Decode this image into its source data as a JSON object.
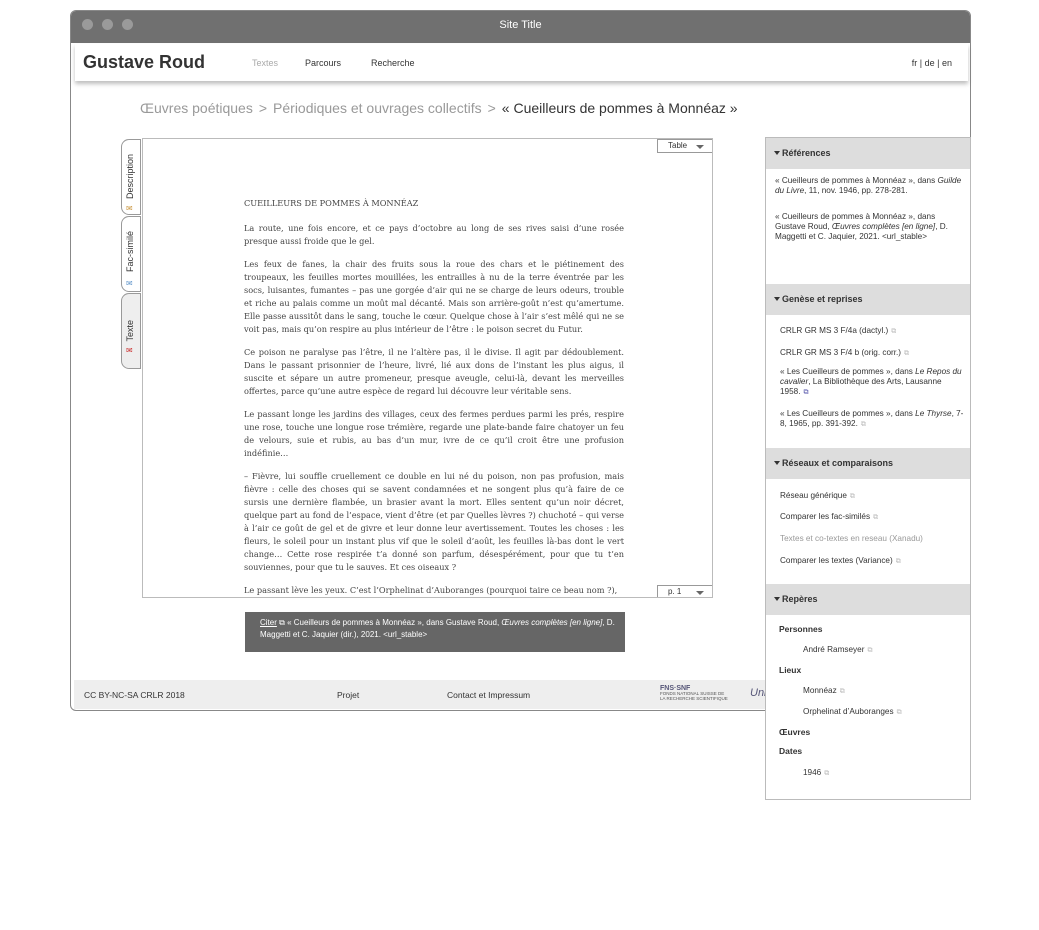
{
  "window": {
    "title": "Site Title"
  },
  "header": {
    "brand": "Gustave Roud",
    "nav": [
      "Textes",
      "Parcours",
      "Recherche"
    ],
    "langs": "fr | de | en"
  },
  "breadcrumb": {
    "items": [
      "Œuvres poétiques",
      "Périodiques et ouvrages collectifs"
    ],
    "separator": ">",
    "current": "« Cueilleurs de pommes à Monnéaz »"
  },
  "sidetabs": [
    {
      "label": "Description",
      "icon": "✉"
    },
    {
      "label": "Fac-similé",
      "icon": "✉"
    },
    {
      "label": "Texte",
      "icon": "✉"
    }
  ],
  "viewer": {
    "table_label": "Table",
    "page_label": "p. 1",
    "doc_title": "CUEILLEURS DE POMMES À MONNÉAZ",
    "paragraphs": [
      "La route, une fois encore, et ce pays d’octobre au long de ses rives saisi d’une rosée presque aussi froide que le gel.",
      "Les feux de fanes, la chair des fruits sous la roue des chars et le piétinement des troupeaux, les feuilles mortes mouillées, les entrailles à nu de la terre éventrée par les socs, luisantes, fumantes – pas une gorgée d’air qui ne se charge de leurs odeurs, trouble et riche au palais comme un moût mal décanté. Mais son arrière-goût n’est qu’amertume. Elle passe aussitôt dans le sang, touche le cœur. Quelque chose à l’air s’est mêlé qui ne se voit pas, mais qu’on respire au plus intérieur de l’être : le poison secret du Futur.",
      "Ce poison ne paralyse pas l’être, il ne l’altère pas, il le divise. Il agit par dédoublement. Dans le passant prisonnier de l’heure, livré, lié aux dons de l’instant les plus aigus, il suscite et sépare un autre promeneur, presque aveugle, celui-là, devant les merveilles offertes, parce qu’une autre espèce de regard lui découvre leur véritable sens.",
      "Le passant longe les jardins des villages, ceux des fermes perdues parmi les prés, respire une rose, touche une longue rose trémière, regarde une plate-bande faire chatoyer un feu de velours, suie et rubis, au bas d’un mur, ivre de ce qu’il croit être une profusion indéfinie…",
      "– Fièvre, lui souffle cruellement ce double en lui né du poison, non pas profusion, mais fièvre : celle des choses qui se savent condamnées et ne songent plus qu’à faire de ce sursis une dernière flambée, un brasier avant la mort. Elles sentent qu’un noir décret, quelque part au fond de l’espace, vient d’être (et par Quelles lèvres ?) chuchoté – qui verse à l’air ce goût de gel et de givre et leur donne leur avertissement. Toutes les choses : les fleurs, le soleil pour un instant plus vif que le soleil d’août, les feuilles là-bas dont le vert change… Cette rose respirée t’a donné son parfum, désespérément, pour que tu t’en souviennes, pour que tu le sauves. Et ces oiseaux ?",
      "Le passant lève les yeux. C’est l’Orphelinat d’Auboranges (pourquoi taire ce beau nom ?),"
    ]
  },
  "cite": {
    "link": "Citer",
    "icon": "⧉",
    "pre": " « Cueilleurs de pommes à Monnéaz », dans Gustave Roud, ",
    "italic": "Œuvres complètes [en ligne]",
    "post": ", D. Maggetti et C. Jaquier (dir.), 2021. <url_stable>"
  },
  "footer": {
    "license": "CC BY-NC-SA CRLR 2018",
    "projet": "Projet",
    "contact": "Contact et Impressum",
    "logo_fns_name": "FNS·SNF",
    "logo_fns_sub": "FONDS NATIONAL SUISSE DE LA RECHERCHE SCIENTIFIQUE",
    "logo_unil": "Uni"
  },
  "right_panel": {
    "sections": {
      "references": "Références",
      "genese": "Genèse et reprises",
      "reseaux": "Réseaux et comparaisons",
      "reperes": "Repères"
    },
    "references": [
      {
        "pre": "« Cueilleurs de pommes à Monnéaz », dans ",
        "italic": "Guilde du Livre",
        "post": ", 11, nov. 1946, pp. 278-281."
      },
      {
        "pre": " « Cueilleurs de pommes à Monnéaz », dans Gustave Roud, ",
        "italic": "Œuvres complètes [en ligne]",
        "post": ", D. Maggetti et C. Jaquier, 2021. <url_stable>"
      }
    ],
    "genese": [
      {
        "text": "CRLR GR MS 3 F/4a (dactyl.)"
      },
      {
        "text": "CRLR GR MS 3 F/4 b (orig. corr.)"
      },
      {
        "pre": "« Les Cueilleurs de pommes », dans ",
        "italic": "Le Repos du cavalier",
        "post": ", La Bibliothèque des Arts, Lausanne 1958."
      },
      {
        "pre": "« Les Cueilleurs de pommes », dans ",
        "italic": "Le Thyrse",
        "post": ", 7-8, 1965, pp. 391-392."
      }
    ],
    "reseaux": [
      {
        "text": "Réseau générique",
        "muted": false
      },
      {
        "text": "Comparer les fac-similés",
        "muted": false
      },
      {
        "text": "Textes et co-textes en reseau (Xanadu)",
        "muted": true
      },
      {
        "text": "Comparer les textes (Variance)",
        "muted": false
      }
    ],
    "reperes": {
      "personnes_label": "Personnes",
      "personnes": [
        "André Ramseyer"
      ],
      "lieux_label": "Lieux",
      "lieux": [
        "Monnéaz",
        "Orphelinat d’Auboranges"
      ],
      "oeuvres_label": "Œuvres",
      "dates_label": "Dates",
      "dates": [
        "1946"
      ]
    },
    "ext_icon": "⧉"
  }
}
